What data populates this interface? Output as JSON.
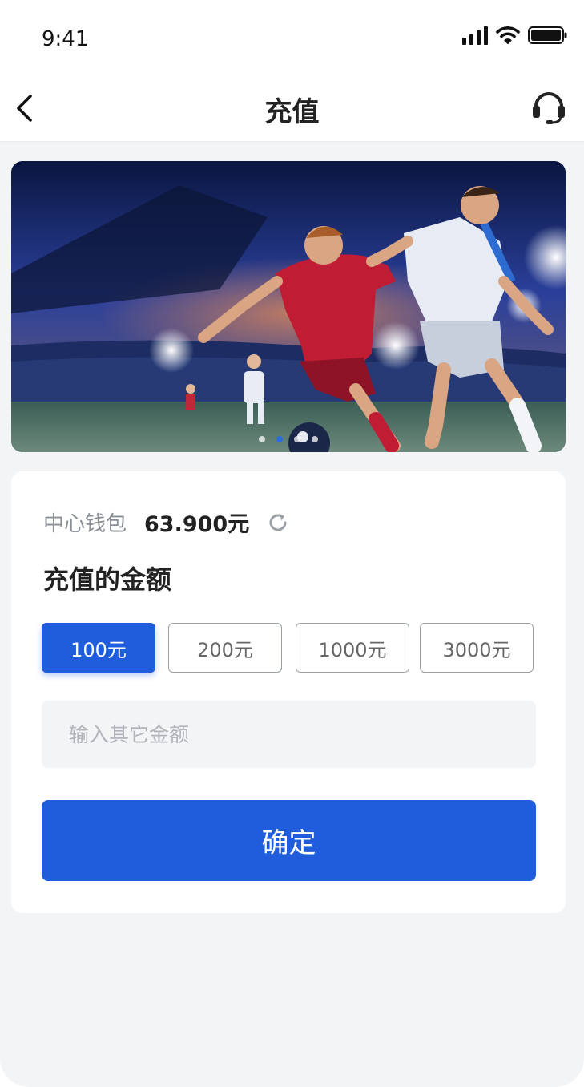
{
  "status_bar": {
    "time": "9:41"
  },
  "nav": {
    "title": "充值"
  },
  "banner": {
    "slide_count": 4,
    "active_slide": 2
  },
  "wallet": {
    "label": "中心钱包",
    "amount": "63.900元"
  },
  "recharge": {
    "section_title": "充值的金额",
    "options": [
      "100元",
      "200元",
      "1000元",
      "3000元"
    ],
    "selected_index": 0,
    "custom_placeholder": "输入其它金额",
    "confirm_label": "确定"
  },
  "colors": {
    "accent": "#1f5ddc",
    "page_bg": "#f3f4f6"
  },
  "icons": [
    "back-icon",
    "headset-icon",
    "refresh-icon",
    "signal-icon",
    "wifi-icon",
    "battery-icon"
  ]
}
